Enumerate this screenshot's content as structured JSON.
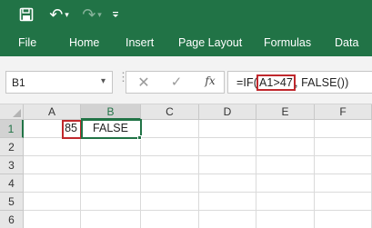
{
  "quick_access": {
    "save_icon": "save-icon",
    "undo_icon": "undo-icon",
    "redo_icon": "redo-icon",
    "customize_icon": "customize-icon",
    "undo_glyph": "↶",
    "redo_glyph": "↷",
    "dropdown_glyph": "▾"
  },
  "ribbon": {
    "tabs": [
      "File",
      "Home",
      "Insert",
      "Page Layout",
      "Formulas",
      "Data"
    ],
    "accent_color": "#217346"
  },
  "formula_bar": {
    "name_box": "B1",
    "name_box_arrow": "▾",
    "cancel_glyph": "✕",
    "enter_glyph": "✓",
    "fx_label": "fx",
    "formula_prefix": "=IF(",
    "formula_highlight": "A1>47",
    "formula_suffix": ", FALSE())",
    "highlight_color": "#c0282d"
  },
  "sheet": {
    "columns": [
      "A",
      "B",
      "C",
      "D",
      "E",
      "F"
    ],
    "rows": [
      "1",
      "2",
      "3",
      "4",
      "5",
      "6"
    ],
    "active_cell": "B1",
    "referenced_cell": "A1",
    "cells": {
      "A1": "85",
      "B1": "FALSE"
    }
  }
}
